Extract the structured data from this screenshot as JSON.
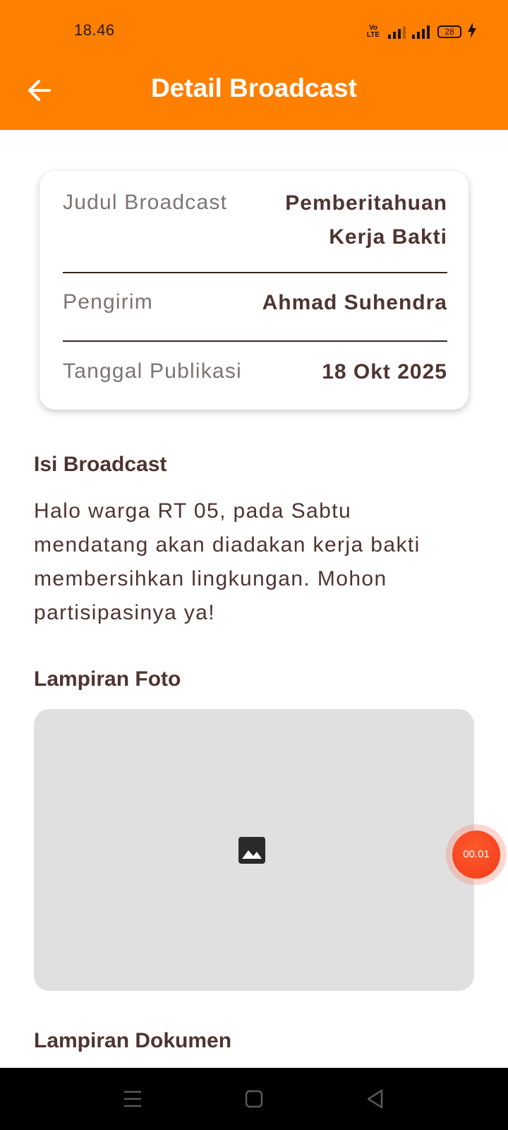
{
  "status_bar": {
    "time": "18.46",
    "volte_label": "Vo LTE",
    "battery_level": "28"
  },
  "header": {
    "title": "Detail Broadcast",
    "back_icon": "arrow-left-icon",
    "background_color": "#ff7f00"
  },
  "info_card": {
    "rows": [
      {
        "label": "Judul Broadcast",
        "value": "Pemberitahuan Kerja Bakti"
      },
      {
        "label": "Pengirim",
        "value": "Ahmad Suhendra"
      },
      {
        "label": "Tanggal Publikasi",
        "value": "18 Okt 2025"
      }
    ]
  },
  "content": {
    "isi_title": "Isi Broadcast",
    "isi_text": "Halo warga RT 05, pada Sabtu mendatang akan diadakan kerja bakti membersihkan lingkungan. Mohon partisipasinya ya!",
    "foto_title": "Lampiran Foto",
    "foto_icon": "image-icon",
    "dokumen_title": "Lampiran Dokumen"
  },
  "screen_recorder": {
    "timer": "00.01",
    "color": "#f23b16"
  },
  "nav_bar": {
    "icons": [
      "menu-icon",
      "home-icon",
      "back-icon"
    ]
  }
}
